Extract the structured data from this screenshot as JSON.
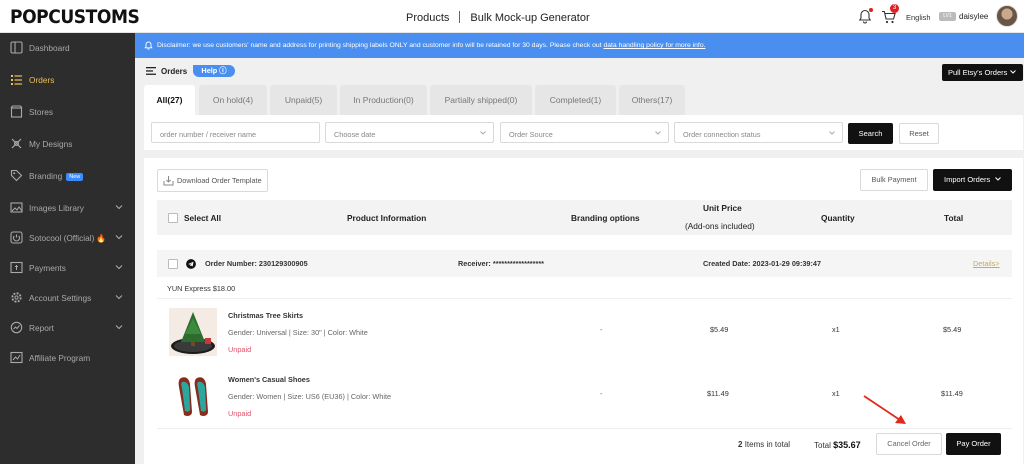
{
  "brand": {
    "logo": "POPCUSTOMS"
  },
  "topnav": {
    "products": "Products",
    "mockup": "Bulk Mock-up Generator"
  },
  "header": {
    "cart_count": "3",
    "language": "English",
    "vip": "LV1",
    "username": "daisylee"
  },
  "sidebar": {
    "items": [
      {
        "label": "Dashboard",
        "icon": "dashboard-icon"
      },
      {
        "label": "Orders",
        "icon": "list-icon",
        "active": true
      },
      {
        "label": "Stores",
        "icon": "store-icon"
      },
      {
        "label": "My Designs",
        "icon": "design-icon"
      },
      {
        "label": "Branding",
        "icon": "tag-icon",
        "badge": "New"
      },
      {
        "label": "Images Library",
        "icon": "image-icon"
      },
      {
        "label": "Sotocool (Official)",
        "icon": "power-icon",
        "fire": "🔥"
      },
      {
        "label": "Payments",
        "icon": "payments-icon"
      },
      {
        "label": "Account Settings",
        "icon": "gear-icon"
      },
      {
        "label": "Report",
        "icon": "report-icon"
      },
      {
        "label": "Affiliate Program",
        "icon": "affiliate-icon"
      }
    ]
  },
  "disclaimer": {
    "text": "Disclaimer: we use customers' name and address for printing shipping labels ONLY and customer info will be retained for 30 days. Please check out ",
    "link": "data handling policy for more info."
  },
  "orders": {
    "title": "Orders",
    "help": "Help",
    "pull_btn": "Pull Etsy's Orders"
  },
  "tabs": [
    {
      "label": "All(27)",
      "active": true
    },
    {
      "label": "On hold(4)"
    },
    {
      "label": "Unpaid(5)"
    },
    {
      "label": "In Production(0)"
    },
    {
      "label": "Partially shipped(0)"
    },
    {
      "label": "Completed(1)"
    },
    {
      "label": "Others(17)"
    }
  ],
  "filters": {
    "search_placeholder": "order number / receiver name",
    "date_placeholder": "Choose date",
    "source_placeholder": "Order Source",
    "status_placeholder": "Order connection status",
    "search_btn": "Search",
    "reset_btn": "Reset"
  },
  "toolbar": {
    "download": "Download Order Template",
    "bulk_payment": "Bulk Payment",
    "import": "Import Orders"
  },
  "table": {
    "select_all": "Select All",
    "product_info": "Product Information",
    "branding": "Branding options",
    "unit_price_1": "Unit Price",
    "unit_price_2": "(Add-ons included)",
    "quantity": "Quantity",
    "total": "Total"
  },
  "order": {
    "number": "Order Number: 230129300905",
    "receiver": "Receiver: ******************",
    "created": "Created Date: 2023-01-29 09:39:47",
    "details": "Details>",
    "shipping": "YUN Express $18.00",
    "items": [
      {
        "name": "Christmas Tree Skirts",
        "attrs": "Gender: Universal | Size: 30\" | Color: White",
        "status": "Unpaid",
        "branding": "-",
        "price": "$5.49",
        "qty": "x1",
        "total": "$5.49"
      },
      {
        "name": "Women's Casual Shoes",
        "attrs": "Gender: Women | Size: US6 (EU36) | Color: White",
        "status": "Unpaid",
        "branding": "-",
        "price": "$11.49",
        "qty": "x1",
        "total": "$11.49"
      }
    ],
    "item_count": "2",
    "items_label": "Items in total",
    "total_label": "Total",
    "total_value": "$35.67",
    "cancel_btn": "Cancel Order",
    "pay_btn": "Pay Order"
  },
  "colors": {
    "accent": "#4a8ff0",
    "active_nav": "#e8c15a",
    "sidebar": "#2d2d2d",
    "unpaid": "#e0506a"
  }
}
